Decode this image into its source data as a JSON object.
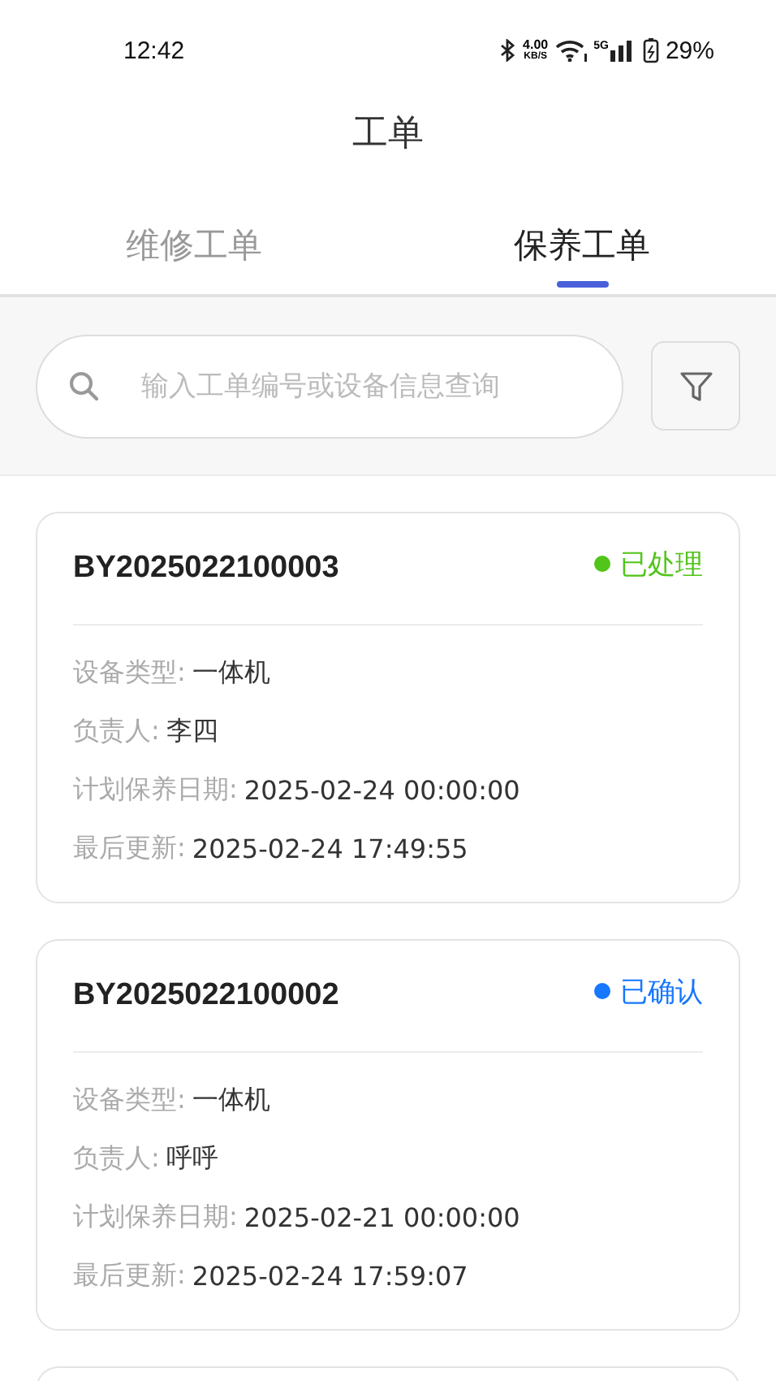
{
  "status_bar": {
    "time": "12:42",
    "speed": "4.00",
    "speed_unit": "KB/S",
    "network": "5G",
    "battery": "29%"
  },
  "header": {
    "title": "工单"
  },
  "tabs": [
    {
      "label": "维修工单",
      "selected": false
    },
    {
      "label": "保养工单",
      "selected": true
    }
  ],
  "search": {
    "placeholder": "输入工单编号或设备信息查询"
  },
  "orders": [
    {
      "number": "BY2025022100003",
      "status": "已处理",
      "color": "#52c41a",
      "fields": [
        {
          "label": "设备类型:",
          "value": "一体机"
        },
        {
          "label": "负责人:",
          "value": "李四"
        },
        {
          "label": "计划保养日期:",
          "value": "2025-02-24 00:00:00"
        },
        {
          "label": "最后更新:",
          "value": "2025-02-24 17:49:55"
        }
      ]
    },
    {
      "number": "BY2025022100002",
      "status": "已确认",
      "color": "#1677ff",
      "fields": [
        {
          "label": "设备类型:",
          "value": "一体机"
        },
        {
          "label": "负责人:",
          "value": "呼呼"
        },
        {
          "label": "计划保养日期:",
          "value": "2025-02-21 00:00:00"
        },
        {
          "label": "最后更新:",
          "value": "2025-02-24 17:59:07"
        }
      ]
    }
  ]
}
